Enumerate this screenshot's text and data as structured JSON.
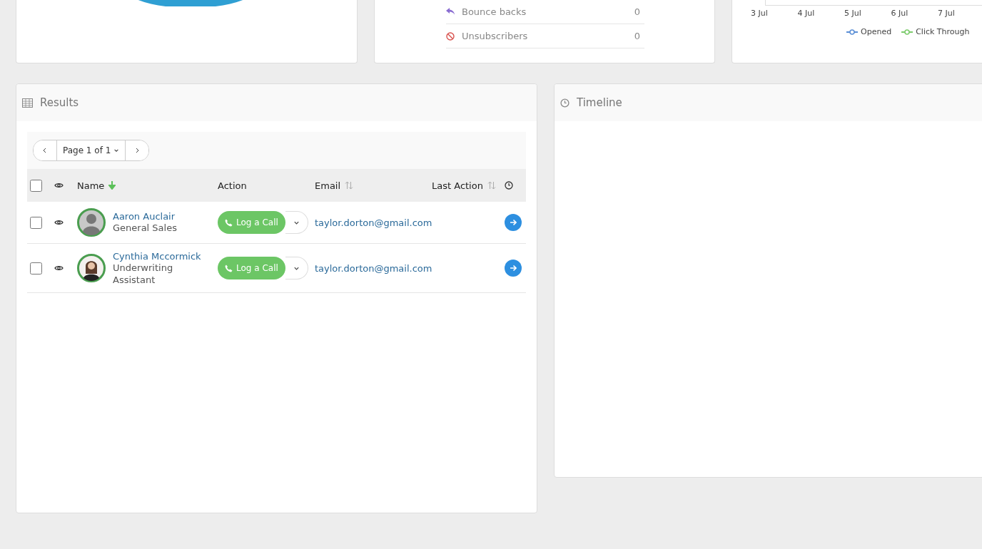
{
  "stats": [
    {
      "kind": "bounce",
      "label": "Bounce backs",
      "value": "0"
    },
    {
      "kind": "unsubscribe",
      "label": "Unsubscribers",
      "value": "0"
    }
  ],
  "trend": {
    "x_labels": [
      "3 Jul",
      "4 Jul",
      "5 Jul",
      "6 Jul",
      "7 Jul"
    ],
    "legend": [
      {
        "label": "Opened",
        "color": "#5b8fd6"
      },
      {
        "label": "Click Through",
        "color": "#7ccb6c"
      }
    ]
  },
  "results": {
    "title": "Results",
    "pager": {
      "label": "Page 1 of 1"
    },
    "select_all": {
      "checked": false
    },
    "columns": [
      {
        "label": "Name",
        "kind": "sorted-down"
      },
      {
        "label": "Action",
        "kind": "plain"
      },
      {
        "label": "Email",
        "kind": "sortable"
      },
      {
        "label": "Last Action",
        "kind": "sortable"
      }
    ],
    "rows": [
      {
        "name": "Aaron Auclair",
        "role": "General Sales",
        "avatar": {
          "kind": "placeholder"
        },
        "action": "Log a Call",
        "email": "taylor.dorton@gmail.com",
        "checked": false
      },
      {
        "name": "Cynthia Mccormick",
        "role": "Underwriting Assistant",
        "avatar": {
          "kind": "photo"
        },
        "action": "Log a Call",
        "email": "taylor.dorton@gmail.com",
        "checked": false
      }
    ]
  },
  "timeline": {
    "title": "Timeline"
  }
}
